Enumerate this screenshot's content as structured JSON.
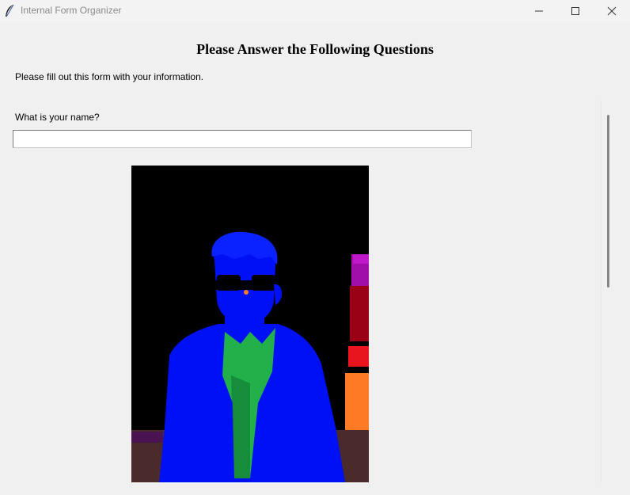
{
  "window": {
    "title": "Internal Form Organizer"
  },
  "form": {
    "heading": "Please Answer the Following Questions",
    "intro": "Please fill out this form with your information.",
    "questions": [
      {
        "label": "What is your name?",
        "value": "",
        "placeholder": ""
      }
    ]
  },
  "icons": {
    "app": "feather-icon",
    "minimize": "minimize-icon",
    "maximize": "maximize-icon",
    "close": "close-icon"
  },
  "colors": {
    "background": "#f0f0f0",
    "titlebar": "#f3f3f3",
    "title_text": "#8a8a8a"
  }
}
